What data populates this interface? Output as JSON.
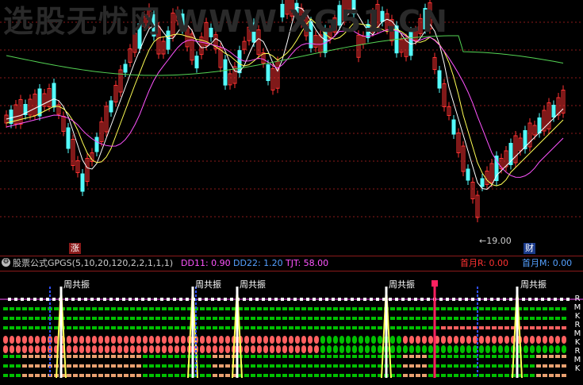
{
  "watermark": "选股无忧网  WWW.XG51.CN",
  "main": {
    "low_price_label": "19.00",
    "badge_zhang": "涨",
    "badge_cai": "财"
  },
  "indicator_bar": {
    "name": "股票公式GPGS(5,10,20,120,2,2,1,1,1)",
    "dd11_label": "DD11: 0.90",
    "dd22_label": "DD22: 1.20",
    "tjt_label": "TJT: 58.00",
    "first_month_r": "首月R: 0.00",
    "first_month_m": "首月M: 0.00"
  },
  "indicator": {
    "markers": [
      "周共振",
      "周共振",
      "周共振",
      "周共振",
      "周共振"
    ],
    "right_labels": [
      "R",
      "M",
      "K",
      "R",
      "M",
      "K",
      "R",
      "M",
      "K"
    ]
  },
  "colors": {
    "up": "#ff3232",
    "down": "#54fcfc",
    "ma5": "#ffffff",
    "ma10": "#ffff54",
    "ma20": "#ff54ff",
    "ma120": "#54d454",
    "grid": "#8b1a1a",
    "dd": "#ff54ff",
    "tjt": "#ff54ff",
    "green": "#00c000",
    "pink": "#ff6060",
    "tan": "#e8a070"
  }
}
